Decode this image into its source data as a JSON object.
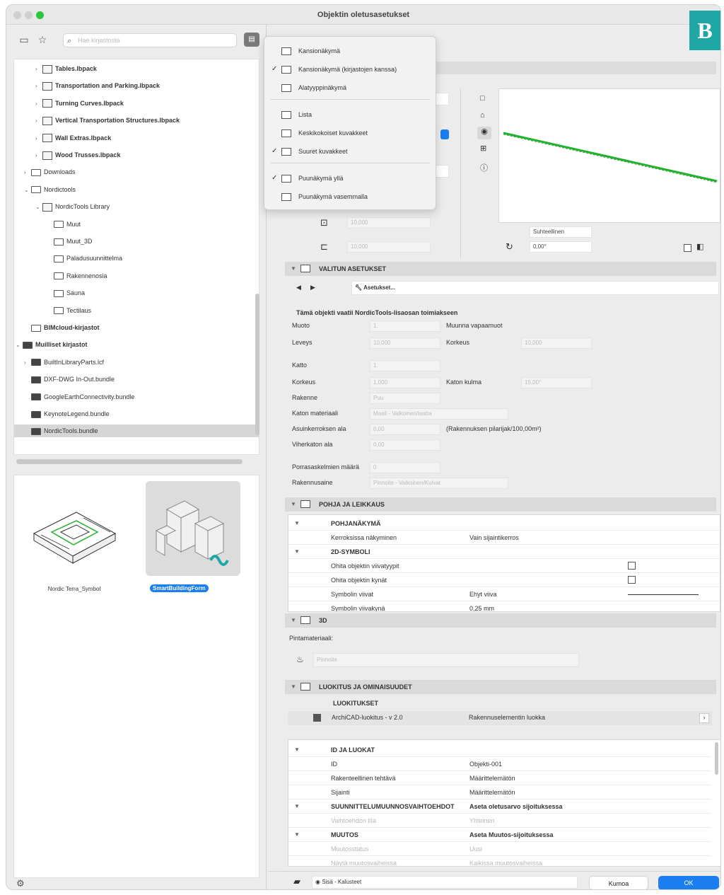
{
  "window": {
    "title": "Objektin oletusasetukset",
    "badge": "B"
  },
  "left": {
    "search": {
      "placeholder": "Hae kirjastosta"
    },
    "tree": [
      {
        "label": "Tables.lbpack",
        "bold": true
      },
      {
        "label": "Transportation and Parking.lbpack",
        "bold": true
      },
      {
        "label": "Turning Curves.lbpack",
        "bold": true
      },
      {
        "label": "Vertical Transportation Structures.lbpack",
        "bold": true
      },
      {
        "label": "Wall Extras.lbpack",
        "bold": true
      },
      {
        "label": "Wood Trusses.lbpack",
        "bold": true
      },
      {
        "label": "Downloads",
        "bold": false
      },
      {
        "label": "Nordictools",
        "bold": false
      },
      {
        "label": "NordicTools Library",
        "bold": false
      },
      {
        "label": "Muut",
        "bold": false
      },
      {
        "label": "Muut_3D",
        "bold": false
      },
      {
        "label": "Paladusuunnittelma",
        "bold": false
      },
      {
        "label": "Rakennenosia",
        "bold": false
      },
      {
        "label": "Sauna",
        "bold": false
      },
      {
        "label": "Tectilaus",
        "bold": false
      },
      {
        "label": "BIMcloud-kirjastot",
        "bold": true
      },
      {
        "label": "Muilliset kirjastot",
        "bold": true
      },
      {
        "label": "BuiltInLibraryParts.lcf",
        "bold": false
      },
      {
        "label": "DXF-DWG In-Out.bundle",
        "bold": false
      },
      {
        "label": "GoogleEarthConnectivity.bundle",
        "bold": false
      },
      {
        "label": "KeynoteLegend.bundle",
        "bold": false
      },
      {
        "label": "NordicTools.bundle",
        "bold": false
      }
    ],
    "thumbs": [
      {
        "label": "Nordic Terra_Symbol"
      },
      {
        "label": "SmartBuildingForm"
      }
    ]
  },
  "menu": {
    "items": [
      {
        "label": "Kansionäkymä",
        "checked": false
      },
      {
        "label": "Kansionäkymä (kirjastojen kanssa)",
        "checked": true
      },
      {
        "label": "Alatyyppinäkymä",
        "checked": false
      },
      {
        "label": "Lista",
        "checked": false
      },
      {
        "label": "Keskikokoiset kuvakkeet",
        "checked": false
      },
      {
        "label": "Suuret kuvakkeet",
        "checked": true
      },
      {
        "label": "Puunäkymä yllä",
        "checked": true
      },
      {
        "label": "Puunäkymä vasemmalla",
        "checked": false
      }
    ]
  },
  "top": {
    "preview_select": "Suhteellinen",
    "angle": "0,00°",
    "field1": "10,000",
    "field2": "10,000"
  },
  "settings": {
    "header": "VALITUN ASETUKSET",
    "param_button": "Asetukset...",
    "intro": "Tämä objekti vaatii NordicTools-lisaosan toimiakseen",
    "rows": [
      {
        "label": "Muoto",
        "value": "1",
        "label2": "Muunna vapaamuot",
        "value2": ""
      },
      {
        "label": "Leveys",
        "value": "10,000",
        "label2": "Korkeus",
        "value2": "10,000"
      },
      {
        "label": "Katto",
        "value": "1",
        "label2": "",
        "value2": ""
      },
      {
        "label": "Korkeus",
        "value": "1,000",
        "label2": "Katon kulma",
        "value2": "15,00°"
      },
      {
        "label": "Rakenne",
        "value": "Puu",
        "label2": "",
        "value2": ""
      },
      {
        "label": "Katon materiaali",
        "value": "Maali - Valkoinen/laatta",
        "label2": "",
        "value2": ""
      },
      {
        "label": "Asuinkerroksen ala",
        "value": "0,00",
        "label2": "(Rakennuksen pilarijak/100,00m²)",
        "value2": ""
      },
      {
        "label": "Viherkaton ala",
        "value": "0,00",
        "label2": "",
        "value2": ""
      },
      {
        "label": "Porrasaskelmien määrä",
        "value": "0",
        "label2": "",
        "value2": ""
      },
      {
        "label": "Rakennusaine",
        "value": "Pinnoite - Valkoinen/Kuivat",
        "label2": "",
        "value2": ""
      }
    ]
  },
  "floorplan": {
    "header": "POHJA JA LEIKKAUS",
    "rows": [
      {
        "label": "POHJANÄKYMÄ",
        "value": "",
        "group": true
      },
      {
        "label": "Kerroksissa näkyminen",
        "value": "Vain sijaintikerros",
        "group": false
      },
      {
        "label": "2D-SYMBOLI",
        "value": "",
        "group": true
      },
      {
        "label": "Ohita objektin viivatyypit",
        "value": "",
        "group": false
      },
      {
        "label": "Ohita objektin kynät",
        "value": "",
        "group": false
      },
      {
        "label": "Symbolin viivat",
        "value": "Ehyt viiva",
        "group": false
      },
      {
        "label": "Symbolin viivakynä",
        "value": "0,25 mm",
        "group": false
      }
    ]
  },
  "three_d": {
    "header": "3D",
    "surface_label": "Pintamateriaali:",
    "surface_value": "Pinnoite"
  },
  "classification": {
    "header": "LUOKITUS JA OMINAISUUDET",
    "group": "LUOKITUKSET",
    "row_label": "ArchiCAD-luokitus - v 2.0",
    "row_value": "Rakennuselementin luokka",
    "props": [
      {
        "label": "ID JA LUOKAT",
        "value": "",
        "group": true,
        "dim": false
      },
      {
        "label": "ID",
        "value": "Objekti-001",
        "group": false,
        "dim": false
      },
      {
        "label": "Rakenteellinen tehtävä",
        "value": "Määrittelemätön",
        "group": false,
        "dim": false
      },
      {
        "label": "Sijainti",
        "value": "Määrittelemätön",
        "group": false,
        "dim": false
      },
      {
        "label": "SUUNNITTELUMUUNNOSVAIHTOEHDOT",
        "value": "Aseta oletusarvo sijoituksessa",
        "group": true,
        "dim": false
      },
      {
        "label": "Vaihtoehdon tila",
        "value": "Yhteinen",
        "group": false,
        "dim": true
      },
      {
        "label": "MUUTOS",
        "value": "Aseta Muutos-sijoituksessa",
        "group": true,
        "dim": false
      },
      {
        "label": "Muutosstatus",
        "value": "Uusi",
        "group": false,
        "dim": true
      },
      {
        "label": "Näytä muutosvaiheissa",
        "value": "Kaikissa muutosvaiheissa",
        "group": false,
        "dim": true
      }
    ]
  },
  "footer": {
    "layer": "Sisä - Kalusteet",
    "cancel": "Kumoa",
    "ok": "OK"
  },
  "colors": {
    "accent": "#1a7df0",
    "badge": "#1fa7a5",
    "line": "#1fb32c"
  }
}
